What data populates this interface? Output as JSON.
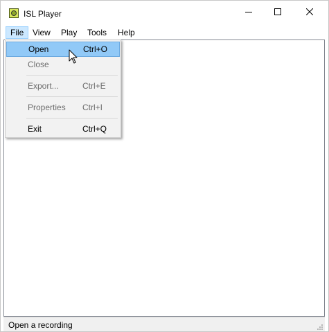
{
  "window": {
    "title": "ISL Player"
  },
  "menubar": {
    "items": [
      "File",
      "View",
      "Play",
      "Tools",
      "Help"
    ]
  },
  "file_menu": {
    "open": {
      "label": "Open",
      "shortcut": "Ctrl+O"
    },
    "close": {
      "label": "Close"
    },
    "export": {
      "label": "Export...",
      "shortcut": "Ctrl+E"
    },
    "properties": {
      "label": "Properties",
      "shortcut": "Ctrl+I"
    },
    "exit": {
      "label": "Exit",
      "shortcut": "Ctrl+Q"
    }
  },
  "statusbar": {
    "text": "Open a recording"
  },
  "colors": {
    "menu_highlight": "#91c9f7",
    "menubar_active": "#cce8ff",
    "disabled_text": "#6d6d6d"
  }
}
